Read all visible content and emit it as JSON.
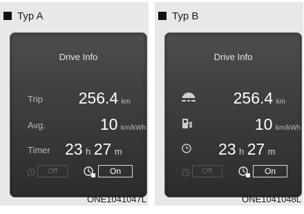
{
  "panels": [
    {
      "variant": "Typ A",
      "title": "Drive Info",
      "trip_label": "Trip",
      "trip_value": "256.4",
      "trip_unit": "km",
      "avg_label": "Avg.",
      "avg_value": "10",
      "avg_unit": "km/kWh",
      "timer_label": "Timer",
      "timer_hours": "23",
      "timer_h_unit": "h",
      "timer_minutes": "27",
      "timer_m_unit": "m",
      "off_label": "Off",
      "on_label": "On",
      "code": "ONE1041047L"
    },
    {
      "variant": "Typ B",
      "title": "Drive Info",
      "trip_value": "256.4",
      "trip_unit": "km",
      "avg_value": "10",
      "avg_unit": "km/kWh",
      "timer_hours": "23",
      "timer_h_unit": "h",
      "timer_minutes": "27",
      "timer_m_unit": "m",
      "off_label": "Off",
      "on_label": "On",
      "code": "ONE1041048L",
      "icons": [
        "car-road-icon",
        "charging-station-icon",
        "clock-icon"
      ]
    }
  ]
}
